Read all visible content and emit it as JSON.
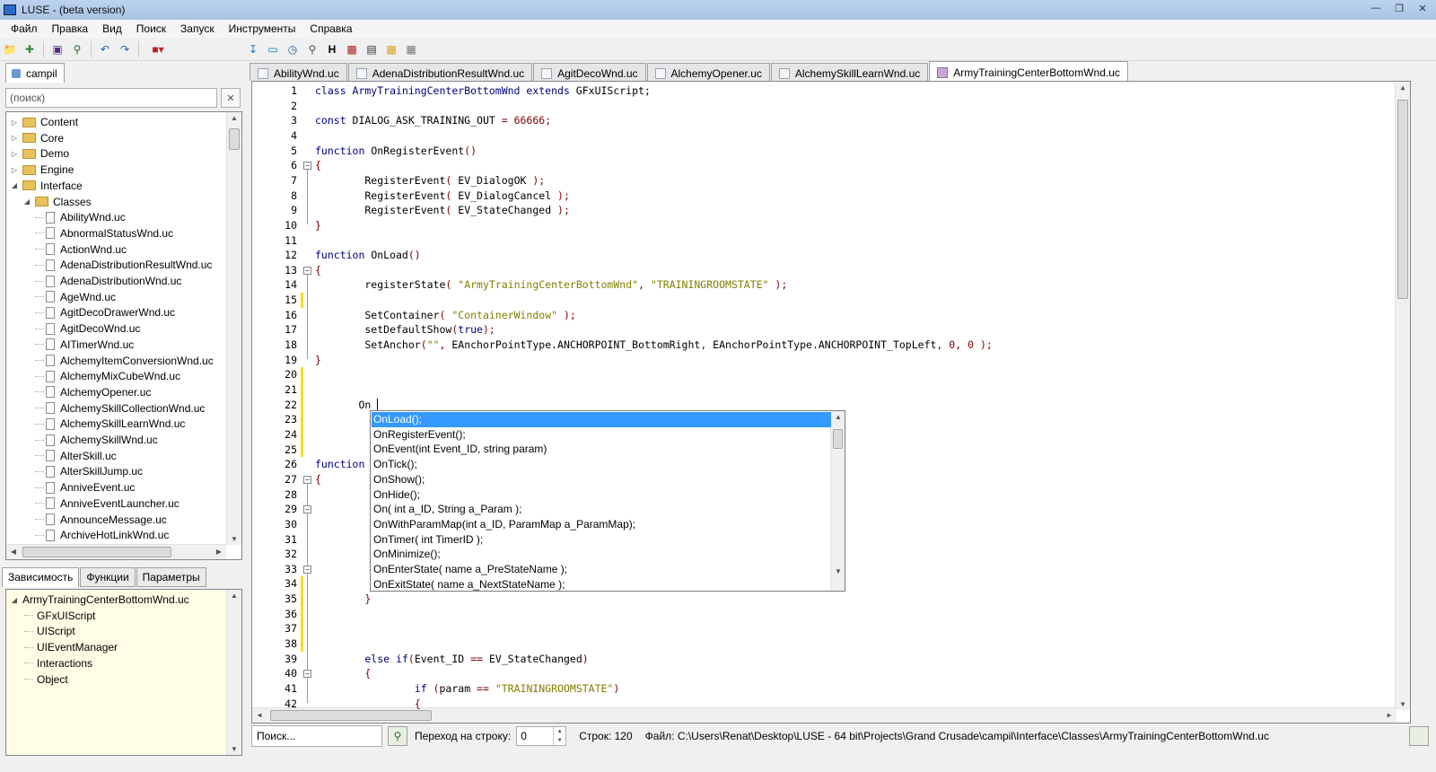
{
  "window": {
    "title": "LUSE - (beta version)"
  },
  "menu": [
    "Файл",
    "Правка",
    "Вид",
    "Поиск",
    "Запуск",
    "Инструменты",
    "Справка"
  ],
  "project": {
    "tab_label": "campil",
    "search_placeholder": "(поиск)",
    "tree": [
      {
        "label": "Content",
        "type": "folder",
        "depth": 0,
        "expander": "▷"
      },
      {
        "label": "Core",
        "type": "folder",
        "depth": 0,
        "expander": "▷"
      },
      {
        "label": "Demo",
        "type": "folder",
        "depth": 0,
        "expander": "▷"
      },
      {
        "label": "Engine",
        "type": "folder",
        "depth": 0,
        "expander": "▷"
      },
      {
        "label": "Interface",
        "type": "folder",
        "depth": 0,
        "expander": "◢"
      },
      {
        "label": "Classes",
        "type": "folder",
        "depth": 1,
        "expander": "◢"
      },
      {
        "label": "AbilityWnd.uc",
        "type": "file",
        "depth": 2
      },
      {
        "label": "AbnormalStatusWnd.uc",
        "type": "file",
        "depth": 2
      },
      {
        "label": "ActionWnd.uc",
        "type": "file",
        "depth": 2
      },
      {
        "label": "AdenaDistributionResultWnd.uc",
        "type": "file",
        "depth": 2
      },
      {
        "label": "AdenaDistributionWnd.uc",
        "type": "file",
        "depth": 2
      },
      {
        "label": "AgeWnd.uc",
        "type": "file",
        "depth": 2
      },
      {
        "label": "AgitDecoDrawerWnd.uc",
        "type": "file",
        "depth": 2
      },
      {
        "label": "AgitDecoWnd.uc",
        "type": "file",
        "depth": 2
      },
      {
        "label": "AITimerWnd.uc",
        "type": "file",
        "depth": 2
      },
      {
        "label": "AlchemyItemConversionWnd.uc",
        "type": "file",
        "depth": 2
      },
      {
        "label": "AlchemyMixCubeWnd.uc",
        "type": "file",
        "depth": 2
      },
      {
        "label": "AlchemyOpener.uc",
        "type": "file",
        "depth": 2
      },
      {
        "label": "AlchemySkillCollectionWnd.uc",
        "type": "file",
        "depth": 2
      },
      {
        "label": "AlchemySkillLearnWnd.uc",
        "type": "file",
        "depth": 2
      },
      {
        "label": "AlchemySkillWnd.uc",
        "type": "file",
        "depth": 2
      },
      {
        "label": "AlterSkill.uc",
        "type": "file",
        "depth": 2
      },
      {
        "label": "AlterSkillJump.uc",
        "type": "file",
        "depth": 2
      },
      {
        "label": "AnniveEvent.uc",
        "type": "file",
        "depth": 2
      },
      {
        "label": "AnniveEventLauncher.uc",
        "type": "file",
        "depth": 2
      },
      {
        "label": "AnnounceMessage.uc",
        "type": "file",
        "depth": 2
      },
      {
        "label": "ArchiveHotLinkWnd.uc",
        "type": "file",
        "depth": 2
      }
    ]
  },
  "deps": {
    "tabs": [
      "Зависимость",
      "Функции",
      "Параметры"
    ],
    "tree": [
      {
        "label": "ArmyTrainingCenterBottomWnd.uc",
        "depth": 0
      },
      {
        "label": "GFxUIScript",
        "depth": 1
      },
      {
        "label": "UIScript",
        "depth": 1
      },
      {
        "label": "UIEventManager",
        "depth": 1
      },
      {
        "label": "Interactions",
        "depth": 1
      },
      {
        "label": "Object",
        "depth": 1
      }
    ]
  },
  "editor": {
    "tabs": [
      "AbilityWnd.uc",
      "AdenaDistributionResultWnd.uc",
      "AgitDecoWnd.uc",
      "AlchemyOpener.uc",
      "AlchemySkillLearnWnd.uc",
      "ArmyTrainingCenterBottomWnd.uc"
    ],
    "active_tab": 5,
    "lines": [
      [
        [
          "class ArmyTrainingCenterBottomWnd ",
          "kw"
        ],
        [
          "extends ",
          "kw"
        ],
        [
          "GFxUIScript;",
          ""
        ]
      ],
      [],
      [
        [
          "const ",
          "kw"
        ],
        [
          "DIALOG_ASK_TRAINING_OUT ",
          ""
        ],
        [
          "= ",
          "op"
        ],
        [
          "66666",
          "num"
        ],
        [
          ";",
          "op"
        ]
      ],
      [],
      [
        [
          "function ",
          "kw"
        ],
        [
          "OnRegisterEvent",
          ""
        ],
        [
          "()",
          "op"
        ]
      ],
      [
        [
          "{",
          "op"
        ]
      ],
      [
        [
          "        RegisterEvent",
          ""
        ],
        [
          "( ",
          "op"
        ],
        [
          "EV_DialogOK ",
          ""
        ],
        [
          ");",
          "op"
        ]
      ],
      [
        [
          "        RegisterEvent",
          ""
        ],
        [
          "( ",
          "op"
        ],
        [
          "EV_DialogCancel ",
          ""
        ],
        [
          ");",
          "op"
        ]
      ],
      [
        [
          "        RegisterEvent",
          ""
        ],
        [
          "( ",
          "op"
        ],
        [
          "EV_StateChanged ",
          ""
        ],
        [
          ");",
          "op"
        ]
      ],
      [
        [
          "}",
          "op"
        ]
      ],
      [],
      [
        [
          "function ",
          "kw"
        ],
        [
          "OnLoad",
          ""
        ],
        [
          "()",
          "op"
        ]
      ],
      [
        [
          "{",
          "op"
        ]
      ],
      [
        [
          "        registerState",
          ""
        ],
        [
          "( ",
          "op"
        ],
        [
          "\"ArmyTrainingCenterBottomWnd\"",
          "str"
        ],
        [
          ", ",
          "op"
        ],
        [
          "\"TRAININGROOMSTATE\" ",
          "str"
        ],
        [
          ");",
          "op"
        ]
      ],
      [],
      [
        [
          "        SetContainer",
          ""
        ],
        [
          "( ",
          "op"
        ],
        [
          "\"ContainerWindow\" ",
          "str"
        ],
        [
          ");",
          "op"
        ]
      ],
      [
        [
          "        setDefaultShow",
          ""
        ],
        [
          "(",
          "op"
        ],
        [
          "true",
          "kw"
        ],
        [
          ");",
          "op"
        ]
      ],
      [
        [
          "        SetAnchor",
          ""
        ],
        [
          "(",
          "op"
        ],
        [
          "\"\"",
          "str"
        ],
        [
          ", ",
          "op"
        ],
        [
          "EAnchorPointType.ANCHORPOINT_BottomRight",
          ""
        ],
        [
          ", ",
          "op"
        ],
        [
          "EAnchorPointType.ANCHORPOINT_TopLeft",
          ""
        ],
        [
          ", ",
          "op"
        ],
        [
          "0",
          "num"
        ],
        [
          ", ",
          "op"
        ],
        [
          "0 ",
          "num"
        ],
        [
          ");",
          "op"
        ]
      ],
      [
        [
          "}",
          "op"
        ]
      ],
      [],
      [],
      [
        [
          "       On",
          ""
        ]
      ],
      [],
      [],
      [],
      [
        [
          "function",
          "kw"
        ]
      ],
      [
        [
          "{",
          "op"
        ]
      ],
      [],
      [],
      [],
      [],
      [],
      [],
      [],
      [
        [
          "        }",
          "op"
        ]
      ],
      [],
      [],
      [],
      [
        [
          "        else ",
          "kw"
        ],
        [
          "if",
          "kw"
        ],
        [
          "(",
          "op"
        ],
        [
          "Event_ID ",
          ""
        ],
        [
          "== ",
          "op"
        ],
        [
          "EV_StateChanged",
          ""
        ],
        [
          ")",
          "op"
        ]
      ],
      [
        [
          "        {",
          "op"
        ]
      ],
      [
        [
          "                if ",
          "kw"
        ],
        [
          "(",
          "op"
        ],
        [
          "param ",
          ""
        ],
        [
          "== ",
          "op"
        ],
        [
          "\"TRAININGROOMSTATE\"",
          "str"
        ],
        [
          ")",
          "op"
        ]
      ],
      [
        [
          "                {",
          "op"
        ]
      ]
    ],
    "line_numbers": [
      "1",
      "2",
      "3",
      "4",
      "5",
      "6",
      "7",
      "8",
      "9",
      "10",
      "11",
      "12",
      "13",
      "14",
      "15",
      "16",
      "17",
      "18",
      "19",
      "20",
      "21",
      "22",
      "23",
      "24",
      "25",
      "26",
      "27",
      "28",
      "29",
      "30",
      "31",
      "32",
      "33",
      "34",
      "35",
      "36",
      "37",
      "38",
      "39",
      "40",
      "41",
      "42"
    ]
  },
  "autocomplete": {
    "items": [
      "OnLoad();",
      "OnRegisterEvent();",
      "OnEvent(int Event_ID, string param)",
      "OnTick();",
      "OnShow();",
      "OnHide();",
      "On( int a_ID, String a_Param );",
      "OnWithParamMap(int a_ID, ParamMap a_ParamMap);",
      "OnTimer( int TimerID );",
      "OnMinimize();",
      "OnEnterState( name a_PreStateName );",
      "OnExitState( name a_NextStateName );"
    ],
    "selected": 0
  },
  "status": {
    "search_placeholder": "Поиск...",
    "goto_label": "Переход на строку:",
    "goto_value": "0",
    "lines_count": "Строк: 120",
    "file_path": "Файл: C:\\Users\\Renat\\Desktop\\LUSE - 64 bit\\Projects\\Grand Crusade\\campil\\Interface\\Classes\\ArmyTrainingCenterBottomWnd.uc"
  }
}
